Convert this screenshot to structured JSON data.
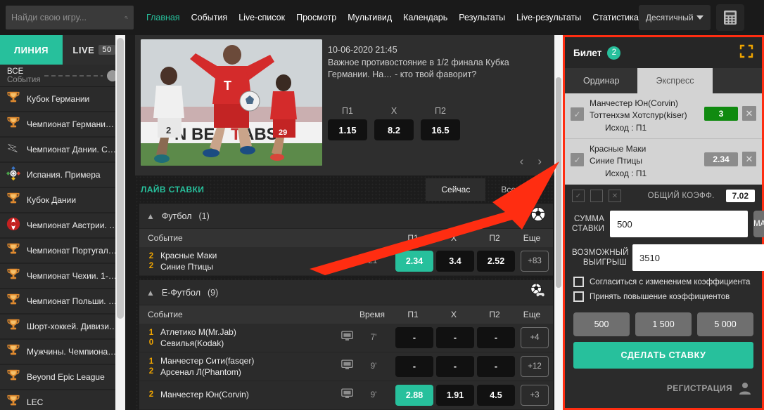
{
  "topbar": {
    "search_placeholder": "Найди свою игру...",
    "search_value": "",
    "search_icon": "search-icon",
    "nav": [
      {
        "label": "Главная",
        "active": true
      },
      {
        "label": "События",
        "active": false
      },
      {
        "label": "Live-список",
        "active": false
      },
      {
        "label": "Просмотр",
        "active": false
      },
      {
        "label": "Мультивид",
        "active": false
      },
      {
        "label": "Календарь",
        "active": false
      },
      {
        "label": "Результаты",
        "active": false
      },
      {
        "label": "Live-результаты",
        "active": false
      },
      {
        "label": "Статистика",
        "active": false
      }
    ],
    "odds_format": "Десятичный",
    "calculator_icon": "calculator-icon"
  },
  "sidebar": {
    "tabs": [
      {
        "label": "ЛИНИЯ",
        "active": true,
        "badge": ""
      },
      {
        "label": "LIVE",
        "active": false,
        "badge": "50"
      }
    ],
    "all_events": {
      "title": "ВСЕ",
      "subtitle": "События"
    },
    "leagues": [
      {
        "label": "Кубок Германии",
        "icon": "trophy-icon"
      },
      {
        "label": "Чемпионат Германи…",
        "icon": "trophy-icon"
      },
      {
        "label": "Чемпионат Дании. С…",
        "icon": "swoosh-icon"
      },
      {
        "label": "Испания. Примера",
        "icon": "laliga-icon"
      },
      {
        "label": "Кубок Дании",
        "icon": "trophy-icon"
      },
      {
        "label": "Чемпионат Австрии. …",
        "icon": "bundesliga-at-icon"
      },
      {
        "label": "Чемпионат Португал…",
        "icon": "trophy-icon"
      },
      {
        "label": "Чемпионат Чехии. 1-…",
        "icon": "trophy-icon"
      },
      {
        "label": "Чемпионат Польши. …",
        "icon": "trophy-icon"
      },
      {
        "label": "Шорт-хоккей. Дивизи…",
        "icon": "trophy-icon"
      },
      {
        "label": "Мужчины. Чемпиона…",
        "icon": "trophy-icon"
      },
      {
        "label": "Beyond Epic League",
        "icon": "trophy-icon"
      },
      {
        "label": "LEC",
        "icon": "trophy-icon"
      }
    ]
  },
  "promo": {
    "datetime": "10-06-2020 21:45",
    "description": "Важное противостояние в 1/2 финала Кубка Германии. На… - кто твой фаворит?",
    "odds": [
      {
        "label": "П1",
        "value": "1.15"
      },
      {
        "label": "X",
        "value": "8.2"
      },
      {
        "label": "П2",
        "value": "16.5"
      }
    ],
    "prev_icon": "chevron-left-icon",
    "next_icon": "chevron-right-icon"
  },
  "live": {
    "title": "ЛАЙВ СТАВКИ",
    "tabs": [
      {
        "label": "Сейчас",
        "active": true
      },
      {
        "label": "Все Лайв",
        "active": false
      }
    ],
    "sections": [
      {
        "title": "Футбол",
        "count": "(1)",
        "icon": "football-icon",
        "columns": {
          "event": "Событие",
          "time": "",
          "p1": "П1",
          "x": "X",
          "p2": "П2",
          "more": "Еще"
        },
        "rows": [
          {
            "scores": [
              "2",
              "2"
            ],
            "teams": [
              "Красные Маки",
              "Синие Птицы"
            ],
            "tv": false,
            "time": "21'",
            "odds": [
              {
                "value": "2.34",
                "selected": true
              },
              {
                "value": "3.4",
                "selected": false
              },
              {
                "value": "2.52",
                "selected": false
              }
            ],
            "more": "+83"
          }
        ]
      },
      {
        "title": "Е-Футбол",
        "count": "(9)",
        "icon": "esports-football-icon",
        "columns": {
          "event": "Событие",
          "time": "Время",
          "p1": "П1",
          "x": "X",
          "p2": "П2",
          "more": "Еще"
        },
        "rows": [
          {
            "scores": [
              "1",
              "0"
            ],
            "teams": [
              "Атлетико М(Mr.Jab)",
              "Севилья(Kodak)"
            ],
            "tv": true,
            "time": "7'",
            "odds": [
              {
                "value": "-",
                "selected": false
              },
              {
                "value": "-",
                "selected": false
              },
              {
                "value": "-",
                "selected": false
              }
            ],
            "more": "+4"
          },
          {
            "scores": [
              "1",
              "2"
            ],
            "teams": [
              "Манчестер Сити(fasqer)",
              "Арсенал Л(Phantom)"
            ],
            "tv": true,
            "time": "9'",
            "odds": [
              {
                "value": "-",
                "selected": false
              },
              {
                "value": "-",
                "selected": false
              },
              {
                "value": "-",
                "selected": false
              }
            ],
            "more": "+12"
          },
          {
            "scores": [
              "2",
              ""
            ],
            "teams": [
              "Манчестер Юн(Corvin)",
              ""
            ],
            "tv": true,
            "time": "9'",
            "odds": [
              {
                "value": "2.88",
                "selected": true
              },
              {
                "value": "1.91",
                "selected": false
              },
              {
                "value": "4.5",
                "selected": false
              }
            ],
            "more": "+3"
          }
        ]
      }
    ]
  },
  "slip": {
    "title": "Билет",
    "count": "2",
    "expand_icon": "expand-icon",
    "tabs": [
      {
        "label": "Ординар",
        "active": false
      },
      {
        "label": "Экспресс",
        "active": true
      }
    ],
    "items": [
      {
        "team1": "Манчестер Юн(Corvin)",
        "team2": "Тоттенхэм Хотспур(kiser)",
        "outcome": "Исход : П1",
        "odd": "3",
        "odd_green": true
      },
      {
        "team1": "Красные Маки",
        "team2": "Синие Птицы",
        "outcome": "Исход : П1",
        "odd": "2.34",
        "odd_green": false
      }
    ],
    "tools": [
      "check-all-icon",
      "copy-icon",
      "clear-all-icon"
    ],
    "total_label": "ОБЩИЙ КОЭФФ.",
    "total_value": "7.02",
    "stake_label": "СУММА СТАВКИ",
    "stake_value": "500",
    "win_label": "ВОЗМОЖНЫЙ ВЫИГРЫШ",
    "win_value": "3510",
    "max_label": "MAX",
    "checkbox1": "Согласиться с изменением коэффициента",
    "checkbox2": "Принять повышение коэффициентов",
    "quick_amounts": [
      "500",
      "1 500",
      "5 000"
    ],
    "place_bet": "СДЕЛАТЬ СТАВКУ",
    "register": "РЕГИСТРАЦИЯ",
    "user_icon": "user-icon"
  },
  "colors": {
    "accent": "#27c09c",
    "highlight_border": "#ff2d11",
    "arrow": "#ff2d11",
    "score": "#f0a500",
    "green_odd": "#108a10"
  }
}
